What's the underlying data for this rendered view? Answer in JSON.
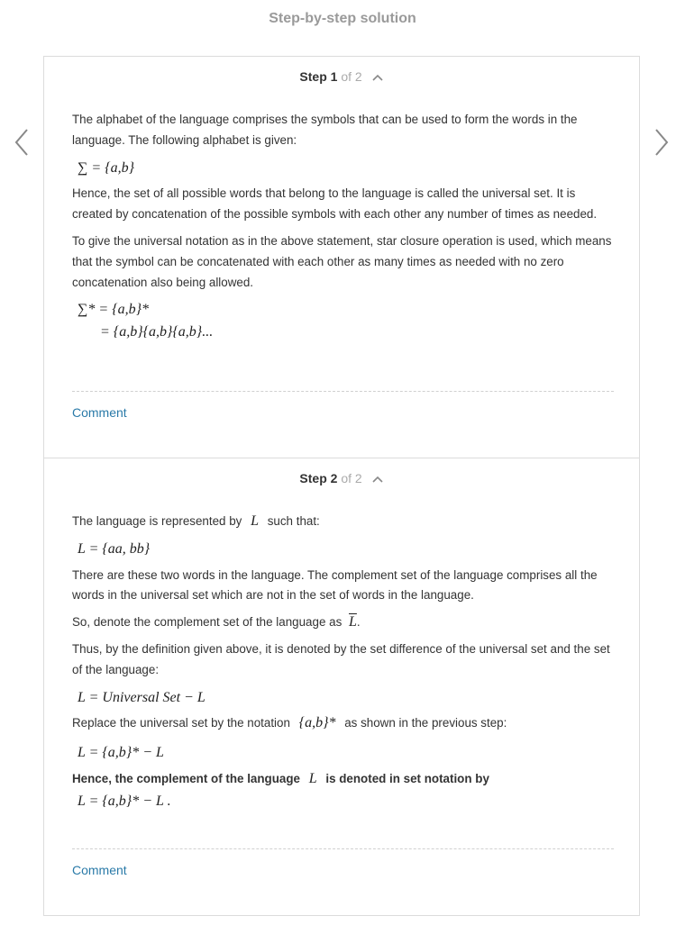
{
  "page": {
    "title": "Step-by-step solution"
  },
  "steps": [
    {
      "label": "Step 1",
      "of": "of 2",
      "p1": "The alphabet of the language comprises the symbols that can be used to form the words in the language. The following alphabet is given:",
      "m1": "∑ = {a,b}",
      "p2": "Hence, the set of all possible words that belong to the language is called the universal set. It is created by concatenation of the possible symbols with each other any number of times as needed.",
      "p3": "To give the universal notation as in the above statement, star closure operation is used, which means that the symbol can be concatenated with each other as many times as needed with no zero concatenation also being allowed.",
      "m2a": "∑* = {a,b}*",
      "m2b": "= {a,b}{a,b}{a,b}...",
      "comment": "Comment"
    },
    {
      "label": "Step 2",
      "of": "of 2",
      "p1a": "The language is represented by",
      "p1sym": "L",
      "p1b": "such that:",
      "m1": "L = {aa, bb}",
      "p2": "There are these two words in the language. The complement set of the language comprises all the words in the universal set which are not in the set of words in the language.",
      "p3a": "So, denote the complement set of the language as",
      "p3sym": "L",
      "p3b": ".",
      "p4": "Thus, by the definition given above, it is denoted by the set difference of the universal set and the set of the language:",
      "m2": "L = Universal Set − L",
      "p5a": "Replace the universal set by the notation",
      "p5sym": "{a,b}*",
      "p5b": "as shown in the previous step:",
      "m3": "L = {a,b}* − L",
      "conc_a": "Hence, the complement of the language",
      "conc_sym": "L",
      "conc_b": "is denoted in set notation by",
      "m4": "L = {a,b}* − L .",
      "comment": "Comment"
    }
  ]
}
